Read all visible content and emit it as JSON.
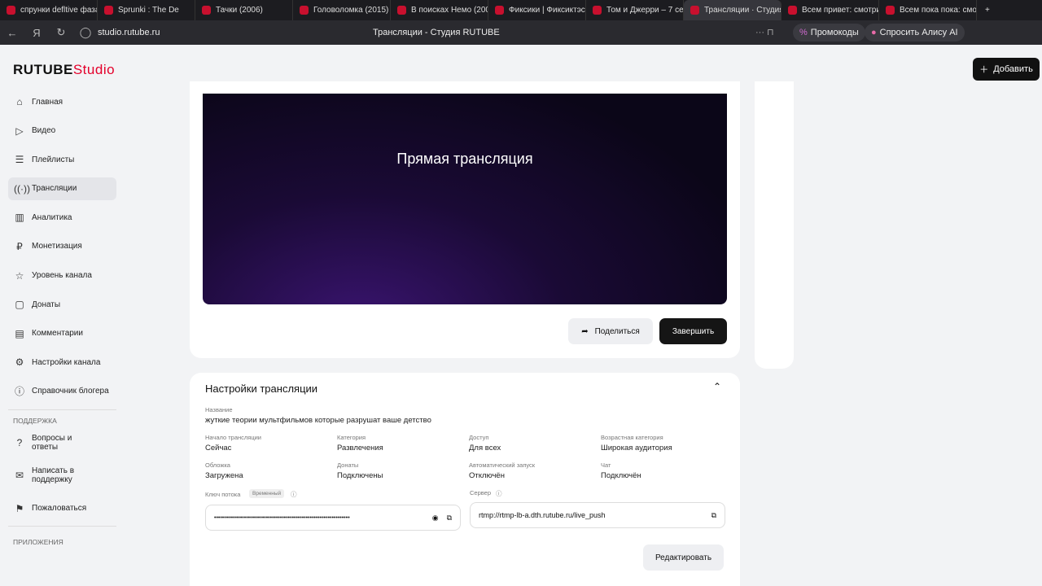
{
  "browser": {
    "tabs": [
      "спрунки defltive фаза",
      "Sprunki : The De",
      "Тачки (2006)",
      "Головоломка (2015)",
      "В поисках Немо (2003)",
      "Фиксики | Фиксиктэс",
      "Том и Джерри – 7 сезон",
      "Трансляции · Студия",
      "Всем привет: смотри",
      "Всем пока пока: смот"
    ],
    "url": "studio.rutube.ru",
    "page_title": "Трансляции - Студия RUTUBE",
    "promo": "Промокоды",
    "alice": "Спросить Алису AI"
  },
  "header": {
    "logo_main": "RUTUBE",
    "logo_sub": "Studio",
    "add": "Добавить"
  },
  "sidebar": {
    "items": [
      {
        "label": "Главная",
        "icon": "⌂"
      },
      {
        "label": "Видео",
        "icon": "▷"
      },
      {
        "label": "Плейлисты",
        "icon": "☰"
      },
      {
        "label": "Трансляции",
        "icon": "((·))"
      },
      {
        "label": "Аналитика",
        "icon": "▥"
      },
      {
        "label": "Монетизация",
        "icon": "₽"
      },
      {
        "label": "Уровень канала",
        "icon": "☆"
      },
      {
        "label": "Донаты",
        "icon": "▢"
      },
      {
        "label": "Комментарии",
        "icon": "▤"
      },
      {
        "label": "Настройки канала",
        "icon": "⚙"
      },
      {
        "label": "Справочник блогера",
        "icon": "ⓘ"
      }
    ],
    "support_title": "ПОДДЕРЖКА",
    "support": [
      {
        "label": "Вопросы и ответы",
        "icon": "?"
      },
      {
        "label": "Написать в поддержку",
        "icon": "✉"
      },
      {
        "label": "Пожаловаться",
        "icon": "⚑"
      }
    ],
    "apps_title": "ПРИЛОЖЕНИЯ"
  },
  "player": {
    "title": "Прямая трансляция",
    "share": "Поделиться",
    "finish": "Завершить"
  },
  "settings": {
    "title": "Настройки трансляции",
    "name_label": "Название",
    "name": "жуткие теории мультфильмов которые разрушат ваше детство",
    "fields": [
      {
        "label": "Начало трансляции",
        "value": "Сейчас"
      },
      {
        "label": "Категория",
        "value": "Развлечения"
      },
      {
        "label": "Доступ",
        "value": "Для всех"
      },
      {
        "label": "Возрастная категория",
        "value": "Широкая аудитория"
      },
      {
        "label": "Обложка",
        "value": "Загружена"
      },
      {
        "label": "Донаты",
        "value": "Подключены"
      },
      {
        "label": "Автоматический запуск",
        "value": "Отключён"
      },
      {
        "label": "Чат",
        "value": "Подключён"
      }
    ],
    "key_label": "Ключ потока",
    "key_badge": "Временный",
    "key_value": "••••••••••••••••••••••••••••••••••••••••••••••••••••••••••••••••••••",
    "server_label": "Сервер",
    "server_value": "rtmp://rtmp-lb-a.dth.rutube.ru/live_push",
    "edit": "Редактировать"
  }
}
